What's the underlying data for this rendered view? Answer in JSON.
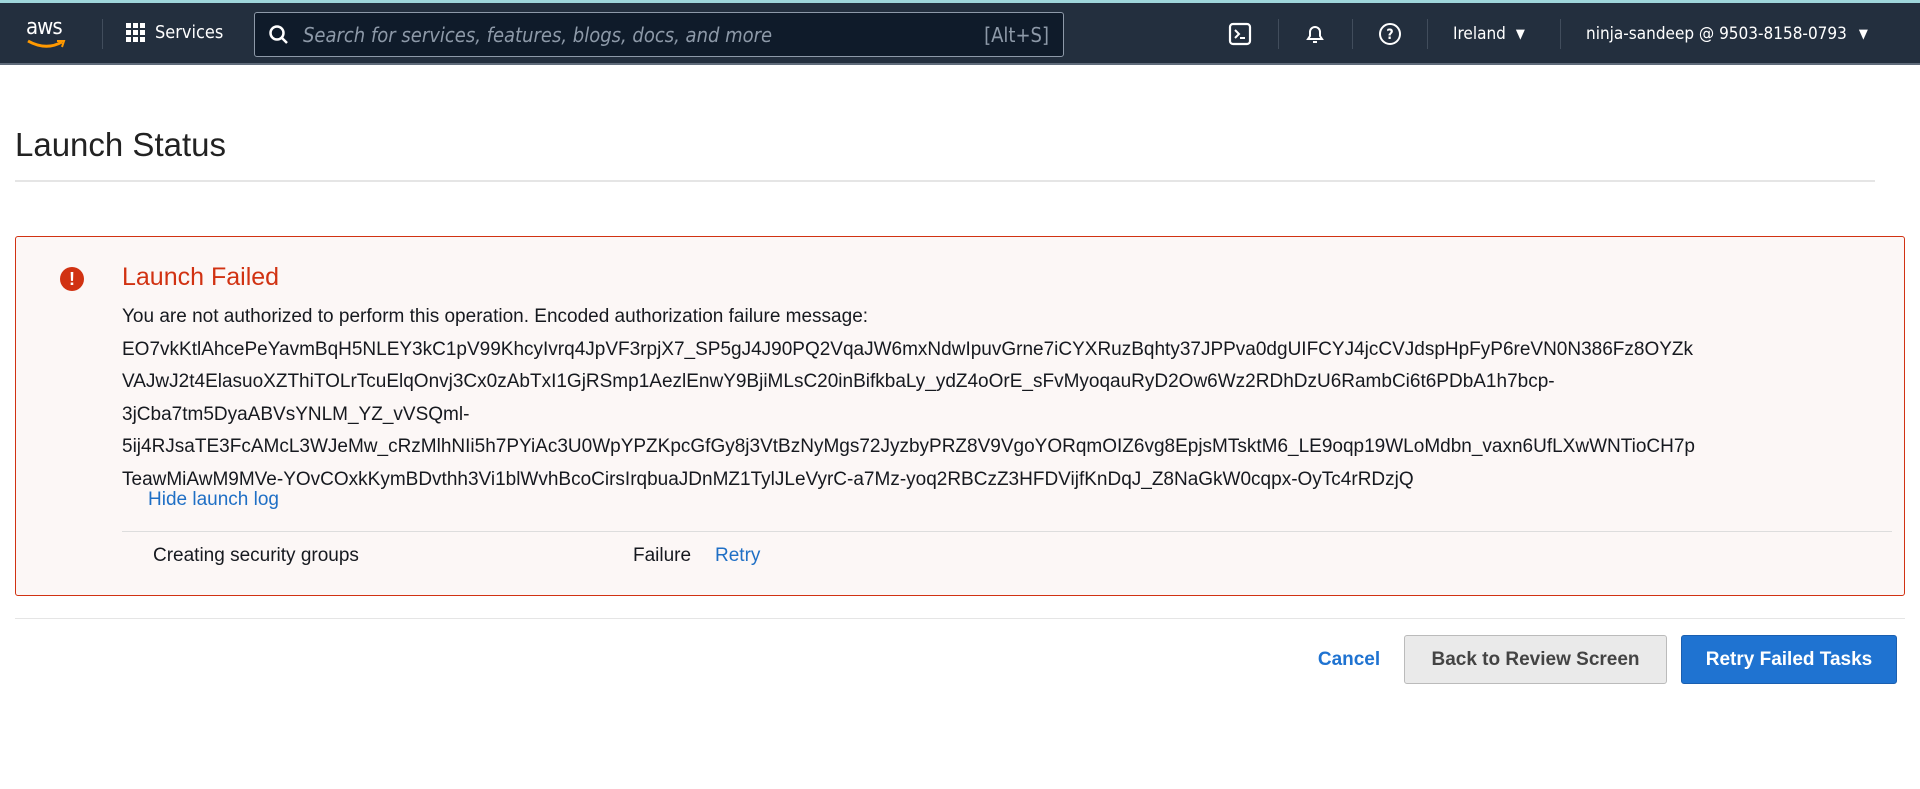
{
  "nav": {
    "logo": "aws",
    "services": "Services",
    "search_placeholder": "Search for services, features, blogs, docs, and more",
    "search_shortcut": "[Alt+S]",
    "region": "Ireland",
    "account": "ninja-sandeep @ 9503-8158-0793"
  },
  "page": {
    "title": "Launch Status"
  },
  "alert": {
    "title": "Launch Failed",
    "color": "#d13212",
    "message_lines": [
      "You are not authorized to perform this operation. Encoded authorization failure message:",
      "EO7vkKtlAhcePeYavmBqH5NLEY3kC1pV99KhcyIvrq4JpVF3rpjX7_SP5gJ4J90PQ2VqaJW6mxNdwIpuvGrne7iCYXRuzBqhty37JPPva0dgUIFCYJ4jcCVJdspHpFyP6reVN0N386Fz8OYZk",
      "VAJwJ2t4ElasuoXZThiTOLrTcuElqOnvj3Cx0zAbTxI1GjRSmp1AezlEnwY9BjiMLsC20inBifkbaLy_ydZ4oOrE_sFvMyoqauRyD2Ow6Wz2RDhDzU6RambCi6t6PDbA1h7bcp-",
      "3jCba7tm5DyaABVsYNLM_YZ_vVSQml-",
      "5ij4RJsaTE3FcAMcL3WJeMw_cRzMlhNIi5h7PYiAc3U0WpYPZKpcGfGy8j3VtBzNyMgs72JyzbyPRZ8V9VgoYORqmOIZ6vg8EpjsMTsktM6_LE9oqp19WLoMdbn_vaxn6UfLXwWNTioCH7p",
      "TeawMiAwM9MVe-YOvCOxkKymBDvthh3Vi1blWvhBcoCirsIrqbuaJDnMZ1TylJLeVyrC-a7Mz-yoq2RBCzZ3HFDVijfKnDqJ_Z8NaGkW0cqpx-OyTc4rRDzjQ"
    ],
    "hide_log": "Hide launch log",
    "log": [
      {
        "task": "Creating security groups",
        "status": "Failure",
        "action": "Retry"
      }
    ]
  },
  "actions": {
    "cancel": "Cancel",
    "back": "Back to Review Screen",
    "retry": "Retry Failed Tasks",
    "primary_color": "#1f73d1"
  }
}
